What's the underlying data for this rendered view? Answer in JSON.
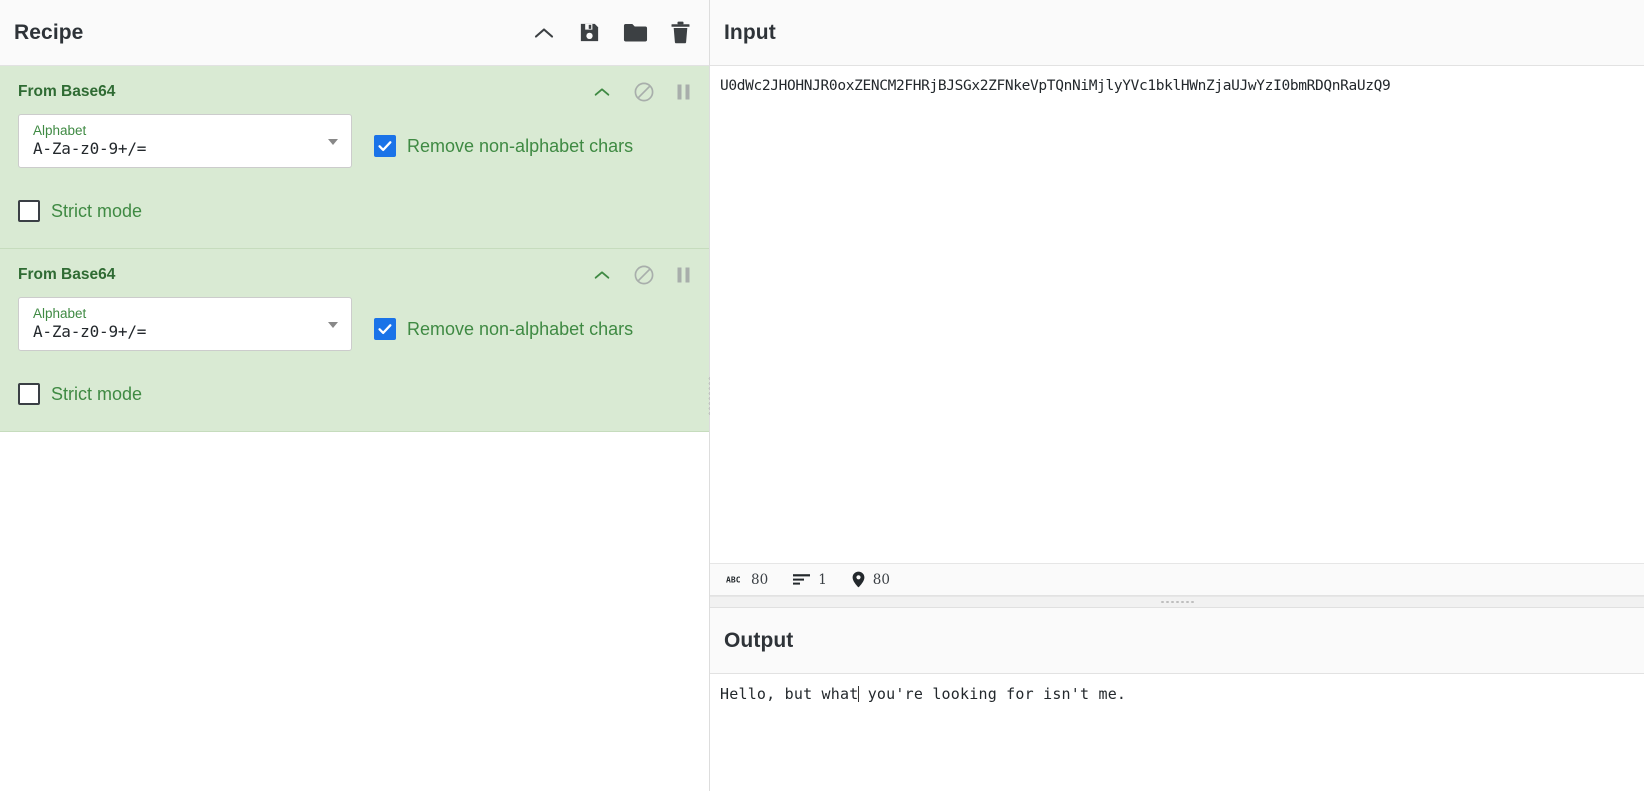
{
  "recipe": {
    "title": "Recipe",
    "header_icons": [
      {
        "name": "collapse-chevron-icon",
        "label": "Collapse all"
      },
      {
        "name": "save-icon",
        "label": "Save recipe"
      },
      {
        "name": "folder-icon",
        "label": "Load recipe"
      },
      {
        "name": "trash-icon",
        "label": "Clear recipe"
      }
    ],
    "operations": [
      {
        "title": "From Base64",
        "icons": [
          "chevron-up-icon",
          "disable-icon",
          "breakpoint-icon"
        ],
        "alphabet_label": "Alphabet",
        "alphabet_value": "A-Za-z0-9+/=",
        "remove_label": "Remove non-alphabet chars",
        "remove_checked": true,
        "strict_label": "Strict mode",
        "strict_checked": false
      },
      {
        "title": "From Base64",
        "icons": [
          "chevron-up-icon",
          "disable-icon",
          "breakpoint-icon"
        ],
        "alphabet_label": "Alphabet",
        "alphabet_value": "A-Za-z0-9+/=",
        "remove_label": "Remove non-alphabet chars",
        "remove_checked": true,
        "strict_label": "Strict mode",
        "strict_checked": false
      }
    ]
  },
  "input": {
    "title": "Input",
    "text": "U0dWc2JHOHNJR0oxZENCM2FHRjBJSGx2ZFNkeVpTQnNiMjlyYVc1bklHWnZjaUJwYzI0bmRDQnRaUzQ9",
    "status": {
      "length_icon": "abc-icon",
      "length": "80",
      "lines_icon": "lines-icon",
      "lines": "1",
      "position_icon": "map-pin-icon",
      "position": "80"
    }
  },
  "output": {
    "title": "Output",
    "text_before_caret": "Hello, but what",
    "text_after_caret": " you're looking for isn't me."
  },
  "colors": {
    "operation_bg": "#d9ead3",
    "operation_text": "#2f6b33",
    "checkbox_on": "#1a73e8",
    "header_bg": "#fafafa",
    "title_text": "#2e3338"
  }
}
